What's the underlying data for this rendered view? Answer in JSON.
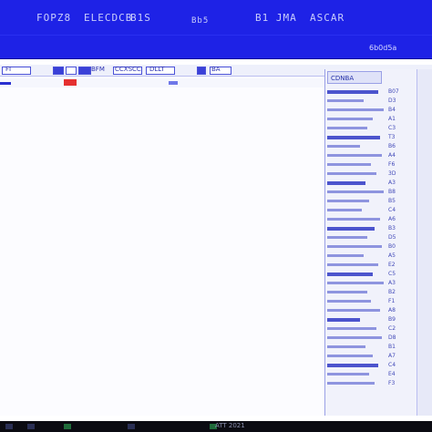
{
  "app": {
    "title_left": "FOPZ8",
    "title_mid": "ELECDCB",
    "title_mid2": "B1S",
    "title_right1": "Bb5",
    "title_right2": "B1 JMA",
    "title_right3": "ASCAR"
  },
  "topbar": {
    "subtitle_right": "6b0d5a"
  },
  "toolbar": {
    "items": [
      "FI",
      "BFM",
      "CCXSCC",
      "DLLT",
      "BA"
    ]
  },
  "panel": {
    "header": "CDNBA",
    "rows": 33,
    "col2": [
      "B07",
      "D3",
      "B4",
      "A1",
      "C3",
      "T3",
      "B6",
      "A4",
      "F6",
      "3D",
      "A3",
      "B8",
      "B5",
      "C4",
      "A6",
      "B3",
      "D5",
      "B0",
      "A5",
      "E2",
      "C5",
      "A3",
      "B2",
      "F1",
      "A8",
      "B9",
      "C2",
      "D8",
      "B1",
      "A7",
      "C4",
      "E4",
      "F3"
    ]
  },
  "colors": {
    "accent": "#1e22e6",
    "alert": "#e53030"
  },
  "taskbar": {
    "text": "ATT 2021"
  }
}
